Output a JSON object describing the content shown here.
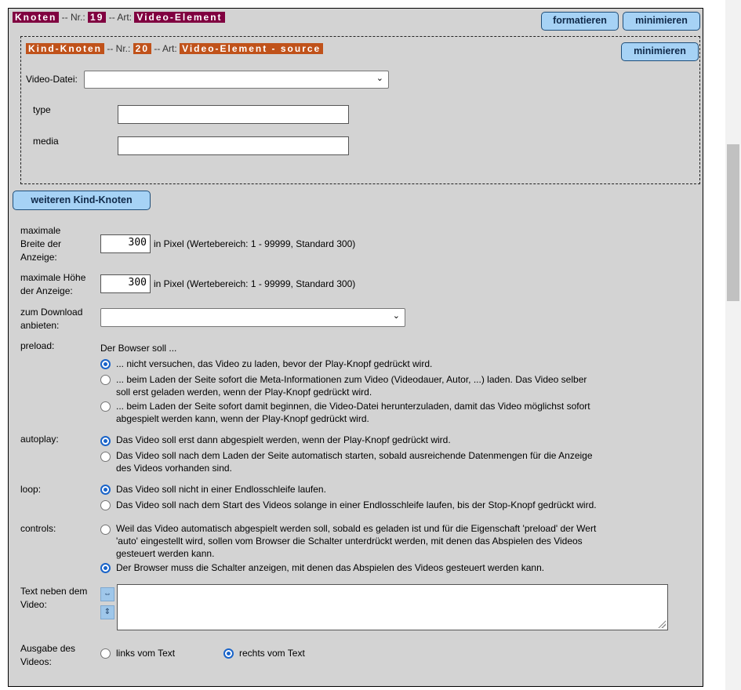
{
  "node": {
    "label": "Knoten",
    "nr_sep": "-- Nr.:",
    "nr": "19",
    "art_sep": "-- Art:",
    "art": "Video-Element",
    "format_btn": "formatieren",
    "minimize_btn": "minimieren"
  },
  "child": {
    "label": "Kind-Knoten",
    "nr_sep": "-- Nr.:",
    "nr": "20",
    "art_sep": "-- Art:",
    "art": "Video-Element - source",
    "minimize_btn": "minimieren",
    "video_file_label": "Video-Datei:",
    "video_file_value": "",
    "type_label": "type",
    "type_value": "",
    "media_label": "media",
    "media_value": ""
  },
  "more_children_btn": "weiteren Kind-Knoten",
  "width": {
    "label_1": "maximale",
    "label_2": "Breite der",
    "label_3": "Anzeige:",
    "value": "300",
    "hint": "in Pixel (Wertebereich: 1 - 99999, Standard 300)"
  },
  "height": {
    "label_1": "maximale Höhe",
    "label_2": "der Anzeige:",
    "value": "300",
    "hint": "in Pixel (Wertebereich: 1 - 99999, Standard 300)"
  },
  "download": {
    "label_1": "zum Download",
    "label_2": "anbieten:",
    "value": ""
  },
  "preload": {
    "label": "preload:",
    "intro": "Der Bowser soll ...",
    "opt1": "... nicht versuchen, das Video zu laden, bevor der Play-Knopf gedrückt wird.",
    "opt2_l1": "... beim Laden der Seite sofort die Meta-Informationen zum Video (Videodauer, Autor, ...) laden. Das Video selber",
    "opt2_l2": "soll erst geladen werden, wenn der Play-Knopf gedrückt wird.",
    "opt3_l1": "... beim Laden der Seite sofort damit beginnen, die Video-Datei herunterzuladen, damit das Video möglichst sofort",
    "opt3_l2": "abgespielt werden kann, wenn der Play-Knopf gedrückt wird.",
    "selected": 1
  },
  "autoplay": {
    "label": "autoplay:",
    "opt1": "Das Video soll erst dann abgespielt werden, wenn der Play-Knopf gedrückt wird.",
    "opt2_l1": "Das Video soll nach dem Laden der Seite automatisch starten, sobald ausreichende Datenmengen für die Anzeige",
    "opt2_l2": "des Videos vorhanden sind.",
    "selected": 1
  },
  "loop": {
    "label": "loop:",
    "opt1": "Das Video soll nicht in einer Endlosschleife laufen.",
    "opt2": "Das Video soll nach dem Start des Videos solange in einer Endlosschleife laufen, bis der Stop-Knopf gedrückt wird.",
    "selected": 1
  },
  "controls": {
    "label": "controls:",
    "opt1_l1": "Weil das Video automatisch abgespielt werden soll, sobald es geladen ist und für die Eigenschaft 'preload' der Wert",
    "opt1_l2": "'auto' eingestellt wird, sollen vom Browser die Schalter unterdrückt werden, mit denen das Abspielen des Videos",
    "opt1_l3": "gesteuert werden kann.",
    "opt2": "Der Browser muss die Schalter anzeigen, mit denen das Abspielen des Videos gesteuert werden kann.",
    "selected": 2
  },
  "side_text": {
    "label_1": "Text neben dem",
    "label_2": "Video:",
    "value": ""
  },
  "output": {
    "label_1": "Ausgabe des",
    "label_2": "Videos:",
    "opt1": "links vom Text",
    "opt2": "rechts vom Text",
    "selected": 2
  },
  "icons": {
    "expand_horizontal": "⇔",
    "expand_vertical": "⇕",
    "chevron": "⌄"
  },
  "colors": {
    "panel_bg": "#d3d3d3",
    "button_bg": "#a6d2f5",
    "tag_maroon": "#800040",
    "tag_orange": "#c0521a",
    "radio_selected": "#1a64c9"
  }
}
